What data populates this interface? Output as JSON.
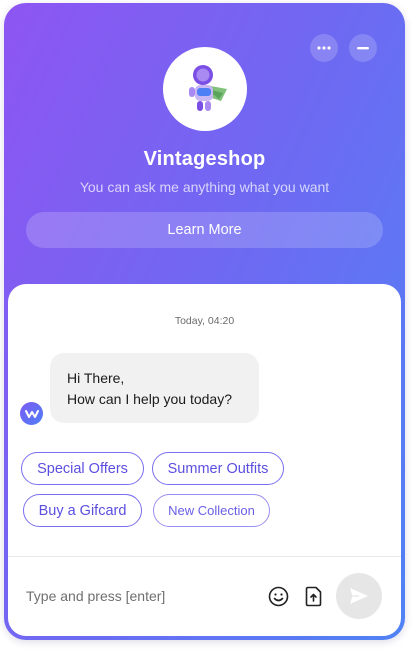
{
  "header": {
    "title": "Vintageshop",
    "subtitle": "You can ask me anything what you want",
    "learn_more_label": "Learn More",
    "more_icon": "more-horizontal-icon",
    "minimize_icon": "minimize-icon",
    "avatar_icon": "astronaut-mascot-icon"
  },
  "chat": {
    "timestamp": "Today, 04:20",
    "messages": [
      {
        "sender": "bot",
        "lines": [
          "Hi There,",
          "How can I help you today?"
        ]
      }
    ],
    "bot_avatar_icon": "bot-logo-icon"
  },
  "quick_replies": [
    "Special Offers",
    "Summer Outfits",
    "Buy a Gifcard",
    "New Collection"
  ],
  "composer": {
    "placeholder": "Type and press [enter]",
    "value": "",
    "emoji_icon": "smiley-icon",
    "upload_icon": "file-upload-icon",
    "send_icon": "send-icon"
  },
  "colors": {
    "gradient_start": "#8e55f3",
    "gradient_end": "#4f82f5",
    "chip_border": "#7a6ff0",
    "chip_text": "#5b4fe0",
    "bubble_bg": "#f1f1f1",
    "send_bg": "#e6e6e6"
  }
}
